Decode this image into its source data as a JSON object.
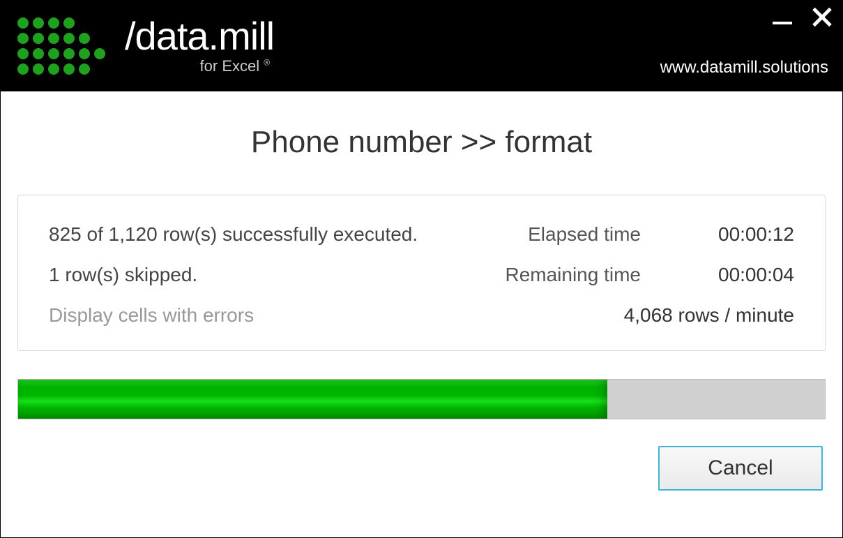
{
  "header": {
    "brand_slash_data": "/data.",
    "brand_mill": "mill",
    "brand_sub": "for Excel",
    "brand_reg": "®",
    "website": "www.datamill.solutions"
  },
  "dialog": {
    "title": "Phone number >> format",
    "executed_text": "825 of 1,120 row(s) successfully executed.",
    "skipped_text": "1 row(s) skipped.",
    "errors_link": "Display cells with errors",
    "elapsed_label": "Elapsed time",
    "elapsed_value": "00:00:12",
    "remaining_label": "Remaining time",
    "remaining_value": "00:00:04",
    "throughput": "4,068 rows / minute",
    "progress_percent": 73,
    "cancel_label": "Cancel"
  }
}
